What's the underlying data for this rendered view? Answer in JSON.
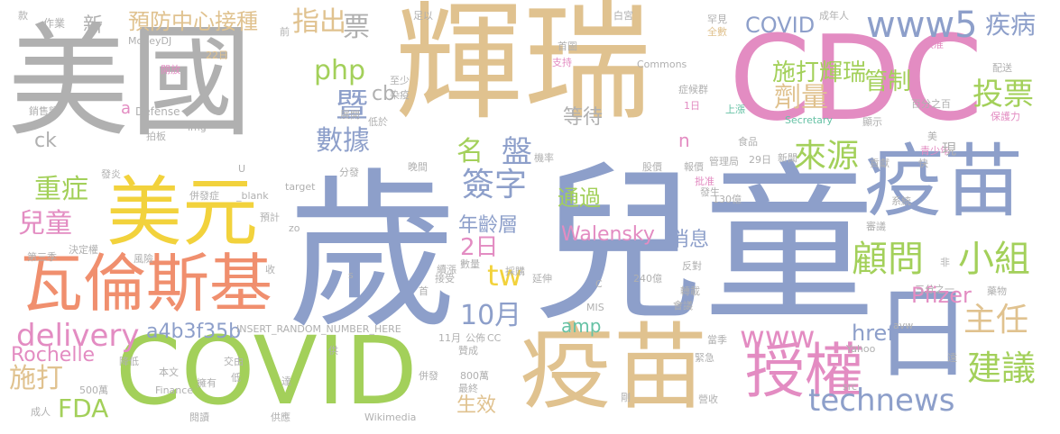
{
  "palette": {
    "gray": "#b0b0b0",
    "tan": "#e0c28f",
    "pink": "#e38cc2",
    "blue": "#8d9fca",
    "green": "#a3d05a",
    "yellow": "#f2d23c",
    "orange": "#f08f6e",
    "teal": "#66c2a5"
  },
  "words": [
    {
      "text": "美國",
      "color": "gray"
    },
    {
      "text": "輝瑞",
      "color": "tan"
    },
    {
      "text": "CDC",
      "color": "pink"
    },
    {
      "text": "歲",
      "color": "blue"
    },
    {
      "text": "兒童",
      "color": "blue"
    },
    {
      "text": "美元",
      "color": "yellow"
    },
    {
      "text": "瓦倫斯基",
      "color": "orange"
    },
    {
      "text": "COVID",
      "color": "green"
    },
    {
      "text": "疫苗",
      "color": "tan"
    },
    {
      "text": "疫苗",
      "color": "blue"
    },
    {
      "text": "日",
      "color": "blue"
    },
    {
      "text": "授權",
      "color": "pink"
    },
    {
      "text": "technews",
      "color": "blue"
    },
    {
      "text": "www5",
      "color": "blue"
    },
    {
      "text": "疾病",
      "color": "blue"
    },
    {
      "text": "預防中心接種",
      "color": "tan"
    },
    {
      "text": "指出",
      "color": "tan"
    },
    {
      "text": "票",
      "color": "gray"
    },
    {
      "text": "COVID",
      "color": "blue"
    },
    {
      "text": "施打輝瑞",
      "color": "green"
    },
    {
      "text": "劑量",
      "color": "tan"
    },
    {
      "text": "管制",
      "color": "green"
    },
    {
      "text": "投票",
      "color": "green"
    },
    {
      "text": "php",
      "color": "green"
    },
    {
      "text": "暨",
      "color": "blue"
    },
    {
      "text": "數據",
      "color": "blue"
    },
    {
      "text": "名",
      "color": "green"
    },
    {
      "text": "盤",
      "color": "blue"
    },
    {
      "text": "簽字",
      "color": "blue"
    },
    {
      "text": "等待",
      "color": "gray"
    },
    {
      "text": "來源",
      "color": "green"
    },
    {
      "text": "顧問",
      "color": "green"
    },
    {
      "text": "小組",
      "color": "green"
    },
    {
      "text": "主任",
      "color": "tan"
    },
    {
      "text": "重症",
      "color": "green"
    },
    {
      "text": "兒童",
      "color": "pink"
    },
    {
      "text": "通過",
      "color": "green"
    },
    {
      "text": "年齡層",
      "color": "blue"
    },
    {
      "text": "2日",
      "color": "pink"
    },
    {
      "text": "tw",
      "color": "yellow"
    },
    {
      "text": "10月",
      "color": "blue"
    },
    {
      "text": "Walensky",
      "color": "pink"
    },
    {
      "text": "消息",
      "color": "blue"
    },
    {
      "text": "www",
      "color": "pink"
    },
    {
      "text": "建議",
      "color": "green"
    },
    {
      "text": "Pfizer",
      "color": "pink"
    },
    {
      "text": "href",
      "color": "blue"
    },
    {
      "text": "delivery",
      "color": "pink"
    },
    {
      "text": "a4b3f35b",
      "color": "blue"
    },
    {
      "text": "amp",
      "color": "teal"
    },
    {
      "text": "施打",
      "color": "tan"
    },
    {
      "text": "Rochelle",
      "color": "pink"
    },
    {
      "text": "FDA",
      "color": "green"
    },
    {
      "text": "生效",
      "color": "tan"
    },
    {
      "text": "新",
      "color": "gray"
    },
    {
      "text": "cb",
      "color": "gray"
    },
    {
      "text": "ck",
      "color": "gray"
    },
    {
      "text": "a",
      "color": "pink"
    },
    {
      "text": "Defense",
      "color": "gray"
    },
    {
      "text": "n",
      "color": "pink"
    },
    {
      "text": "INSERT_RANDOM_NUMBER_HERE",
      "color": "gray"
    },
    {
      "text": "作業",
      "color": "gray"
    },
    {
      "text": "MoneyDJ",
      "color": "gray"
    },
    {
      "text": "開放",
      "color": "pink"
    },
    {
      "text": "22日",
      "color": "tan"
    },
    {
      "text": "展開",
      "color": "gray"
    },
    {
      "text": "銷售額",
      "color": "gray"
    },
    {
      "text": "低於",
      "color": "gray"
    },
    {
      "text": "至少",
      "color": "gray"
    },
    {
      "text": "染疫",
      "color": "gray"
    },
    {
      "text": "首圖",
      "color": "gray"
    },
    {
      "text": "支持",
      "color": "pink"
    },
    {
      "text": "Commons",
      "color": "gray"
    },
    {
      "text": "症候群",
      "color": "gray"
    },
    {
      "text": "1日",
      "color": "pink"
    },
    {
      "text": "罕見",
      "color": "gray"
    },
    {
      "text": "全數",
      "color": "tan"
    },
    {
      "text": "成年人",
      "color": "gray"
    },
    {
      "text": "核准",
      "color": "pink"
    },
    {
      "text": "配送",
      "color": "gray"
    },
    {
      "text": "百分之百",
      "color": "gray"
    },
    {
      "text": "保護力",
      "color": "pink"
    },
    {
      "text": "Secretary",
      "color": "teal"
    },
    {
      "text": "顯示",
      "color": "gray"
    },
    {
      "text": "上漲",
      "color": "teal"
    },
    {
      "text": "美",
      "color": "gray"
    },
    {
      "text": "青少年",
      "color": "pink"
    },
    {
      "text": "食品",
      "color": "gray"
    },
    {
      "text": "新聞",
      "color": "gray"
    },
    {
      "text": "29日",
      "color": "gray"
    },
    {
      "text": "管理局",
      "color": "gray"
    },
    {
      "text": "報價",
      "color": "gray"
    },
    {
      "text": "股價",
      "color": "gray"
    },
    {
      "text": "批准",
      "color": "pink"
    },
    {
      "text": "發生",
      "color": "gray"
    },
    {
      "text": "機率",
      "color": "gray"
    },
    {
      "text": "晚間",
      "color": "gray"
    },
    {
      "text": "分發",
      "color": "gray"
    },
    {
      "text": "發炎",
      "color": "gray"
    },
    {
      "text": "併發症",
      "color": "gray"
    },
    {
      "text": "_blank",
      "color": "gray"
    },
    {
      "text": "target",
      "color": "gray"
    },
    {
      "text": "預計",
      "color": "gray"
    },
    {
      "text": "決定權",
      "color": "gray"
    },
    {
      "text": "第三季",
      "color": "gray"
    },
    {
      "text": "風險",
      "color": "gray"
    },
    {
      "text": "收",
      "color": "gray"
    },
    {
      "text": "續漲",
      "color": "gray"
    },
    {
      "text": "數量",
      "color": "gray"
    },
    {
      "text": "採購",
      "color": "gray"
    },
    {
      "text": "延伸",
      "color": "gray"
    },
    {
      "text": "240億",
      "color": "gray"
    },
    {
      "text": "反對",
      "color": "gray"
    },
    {
      "text": "非",
      "color": "gray"
    },
    {
      "text": "三分之一",
      "color": "gray"
    },
    {
      "text": "藥物",
      "color": "gray"
    },
    {
      "text": "轉載",
      "color": "gray"
    },
    {
      "text": "130億",
      "color": "gray"
    },
    {
      "text": "系統",
      "color": "gray"
    },
    {
      "text": "審議",
      "color": "gray"
    },
    {
      "text": "會議",
      "color": "gray"
    },
    {
      "text": "avw",
      "color": "gray"
    },
    {
      "text": "當季",
      "color": "gray"
    },
    {
      "text": "Yahoo",
      "color": "gray"
    },
    {
      "text": "MIS",
      "color": "gray"
    },
    {
      "text": "公佈",
      "color": "gray"
    },
    {
      "text": "CC",
      "color": "gray"
    },
    {
      "text": "11月",
      "color": "gray"
    },
    {
      "text": "贊成",
      "color": "gray"
    },
    {
      "text": "800萬",
      "color": "gray"
    },
    {
      "text": "最終",
      "color": "gray"
    },
    {
      "text": "併發",
      "color": "gray"
    },
    {
      "text": "剛",
      "color": "gray"
    },
    {
      "text": "營收",
      "color": "gray"
    },
    {
      "text": "src",
      "color": "gray"
    },
    {
      "text": "遠",
      "color": "gray"
    },
    {
      "text": "緊急",
      "color": "gray"
    },
    {
      "text": "擁有",
      "color": "gray"
    },
    {
      "text": "交由",
      "color": "gray"
    },
    {
      "text": "本文",
      "color": "gray"
    },
    {
      "text": "降低",
      "color": "gray"
    },
    {
      "text": "500萬",
      "color": "gray"
    },
    {
      "text": "成人",
      "color": "gray"
    },
    {
      "text": "Finance",
      "color": "gray"
    },
    {
      "text": "達",
      "color": "gray"
    },
    {
      "text": "閱讀",
      "color": "gray"
    },
    {
      "text": "供應",
      "color": "gray"
    },
    {
      "text": "Wikimedia",
      "color": "gray"
    },
    {
      "text": "供",
      "color": "gray"
    },
    {
      "text": "低",
      "color": "gray"
    },
    {
      "text": "款",
      "color": "gray"
    },
    {
      "text": "前",
      "color": "gray"
    },
    {
      "text": "足以",
      "color": "gray"
    },
    {
      "text": "白宮",
      "color": "gray"
    },
    {
      "text": "img",
      "color": "gray"
    },
    {
      "text": "U",
      "color": "gray"
    },
    {
      "text": "zo",
      "color": "gray"
    },
    {
      "text": "首",
      "color": "gray"
    },
    {
      "text": "接受",
      "color": "gray"
    },
    {
      "text": "C",
      "color": "gray"
    },
    {
      "text": "快",
      "color": "gray"
    },
    {
      "text": "貢獻",
      "color": "gray"
    },
    {
      "text": "現",
      "color": "gray"
    },
    {
      "text": "拍板",
      "color": "gray"
    },
    {
      "text": "s",
      "color": "gray"
    }
  ]
}
